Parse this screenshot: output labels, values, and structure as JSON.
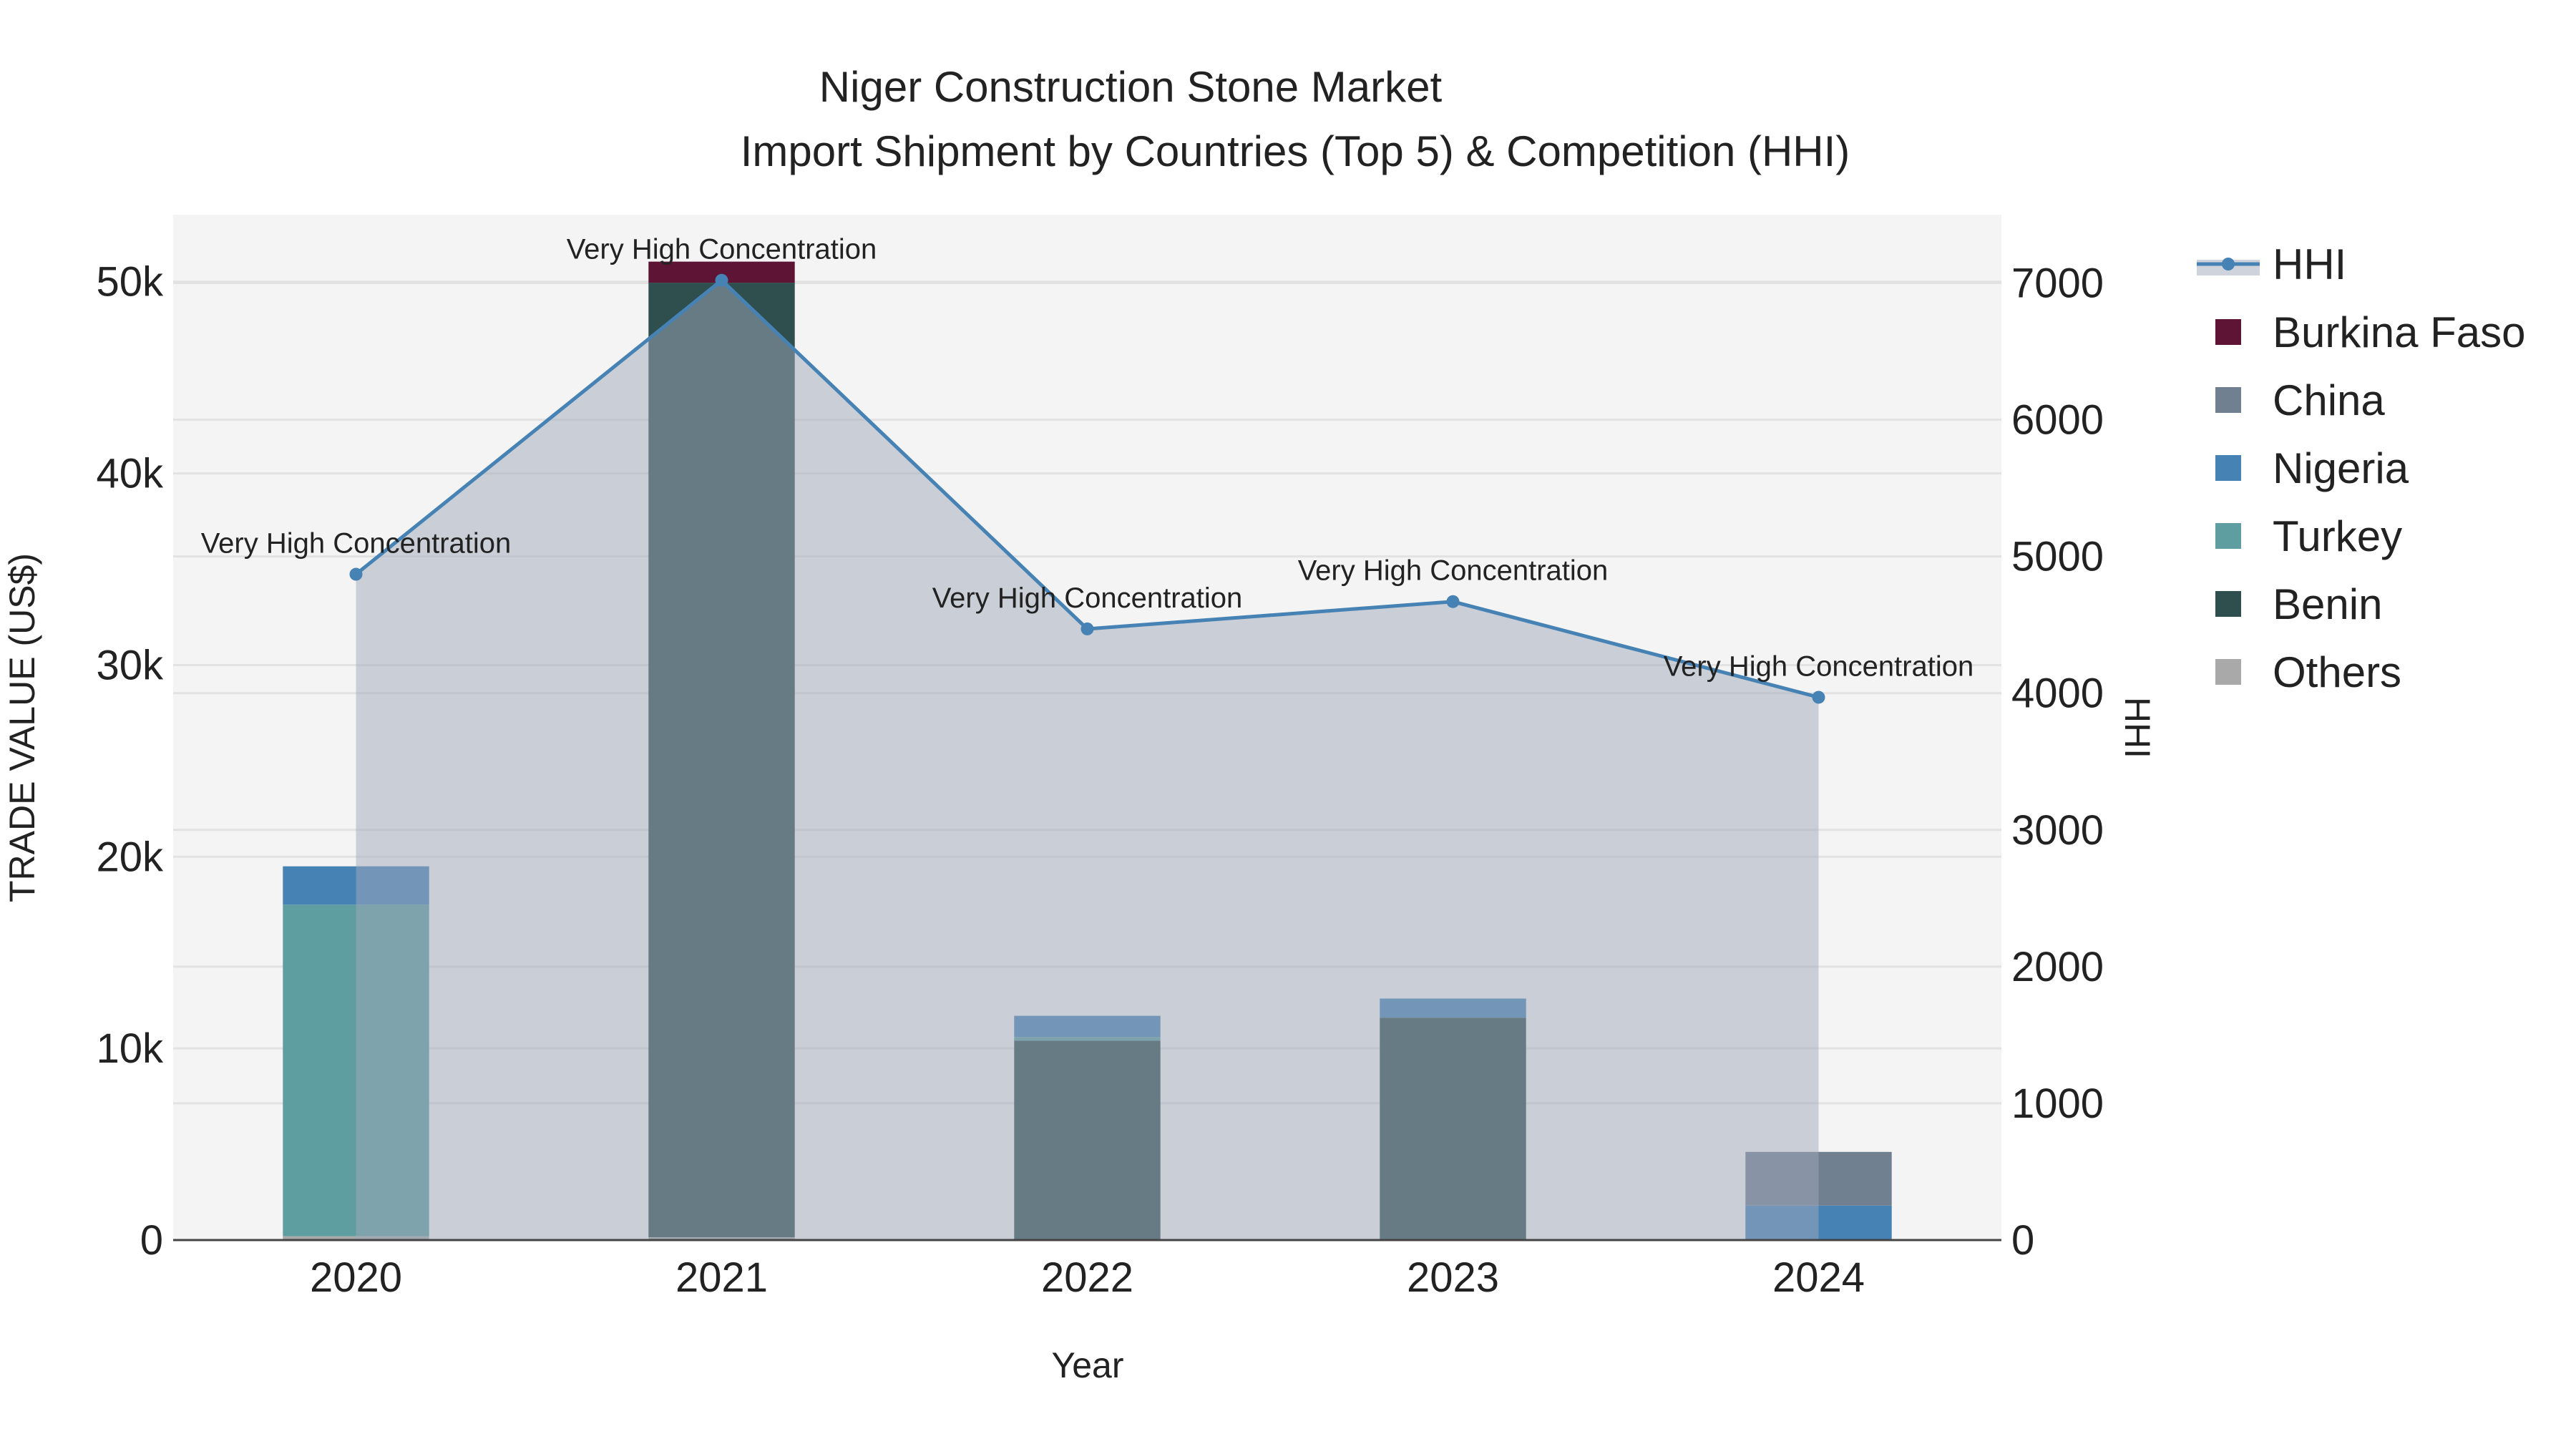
{
  "chart_data": {
    "type": "bar",
    "title": "Niger Construction Stone Market",
    "subtitle": "Import Shipment by Countries (Top 5) & Competition (HHI)",
    "xlabel": "Year",
    "ylabel": "TRADE VALUE (US$)",
    "y2label": "HHI",
    "categories": [
      "2020",
      "2021",
      "2022",
      "2023",
      "2024"
    ],
    "ylim": [
      0,
      53500
    ],
    "y2lim": [
      0,
      7500
    ],
    "yticks": [
      0,
      10000,
      20000,
      30000,
      40000,
      50000
    ],
    "ytick_labels": [
      "0",
      "10k",
      "20k",
      "30k",
      "40k",
      "50k"
    ],
    "y2ticks": [
      0,
      1000,
      2000,
      3000,
      4000,
      5000,
      6000,
      7000
    ],
    "y2tick_labels": [
      "0",
      "1000",
      "2000",
      "3000",
      "4000",
      "5000",
      "6000",
      "7000"
    ],
    "barmode": "stack",
    "series": [
      {
        "name": "Others",
        "color": "#a9a9a9",
        "values": [
          200,
          150,
          0,
          0,
          0
        ]
      },
      {
        "name": "Benin",
        "color": "#2f4f4f",
        "values": [
          0,
          49800,
          10400,
          11600,
          0
        ]
      },
      {
        "name": "Turkey",
        "color": "#5f9ea0",
        "values": [
          17300,
          0,
          200,
          0,
          0
        ]
      },
      {
        "name": "Nigeria",
        "color": "#4682b4",
        "values": [
          2000,
          0,
          1100,
          1000,
          1800
        ]
      },
      {
        "name": "China",
        "color": "#708090",
        "values": [
          0,
          0,
          0,
          0,
          2800
        ]
      },
      {
        "name": "Burkina Faso",
        "color": "#5e1535",
        "values": [
          0,
          1100,
          0,
          0,
          0
        ]
      }
    ],
    "hhi": {
      "name": "HHI",
      "color": "#4682b4",
      "values": [
        4870,
        7020,
        4470,
        4670,
        3970
      ],
      "annotations": [
        "Very High Concentration",
        "Very High Concentration",
        "Very High Concentration",
        "Very High Concentration",
        "Very High Concentration"
      ]
    },
    "legend": [
      "HHI",
      "Burkina Faso",
      "China",
      "Nigeria",
      "Turkey",
      "Benin",
      "Others"
    ],
    "legend_placement": "right",
    "grid": true
  }
}
